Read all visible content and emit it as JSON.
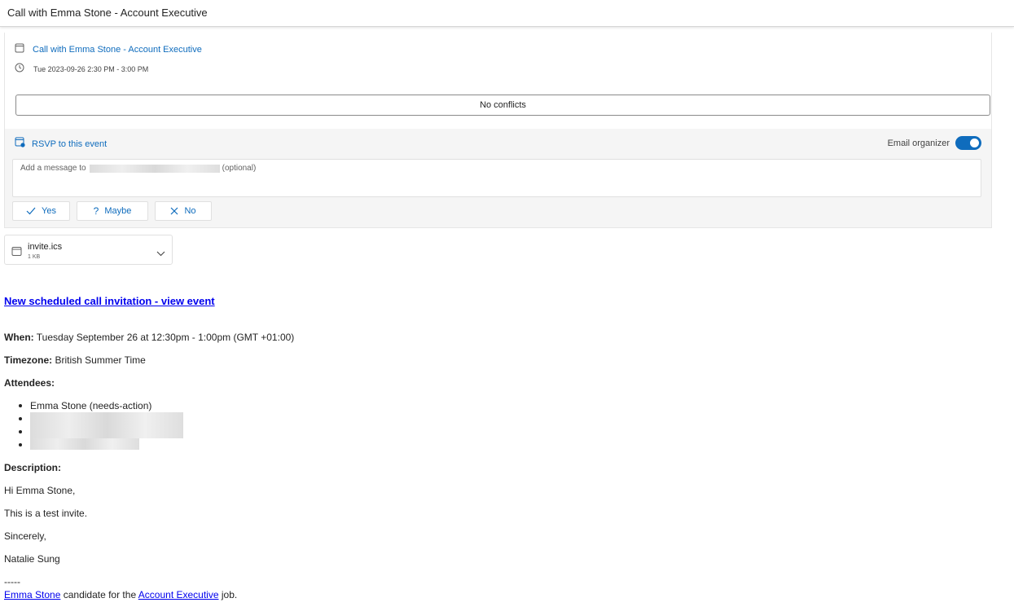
{
  "window": {
    "title": "Call with Emma Stone - Account Executive"
  },
  "event": {
    "title": "Call with Emma Stone - Account Executive",
    "time": "Tue 2023-09-26 2:30 PM - 3:00 PM",
    "conflicts": "No conflicts"
  },
  "rsvp": {
    "label": "RSVP to this event",
    "email_organizer_label": "Email organizer",
    "email_organizer_on": true,
    "message_prefix": "Add a message to",
    "message_suffix": "(optional)",
    "yes": "Yes",
    "maybe": "Maybe",
    "no": "No"
  },
  "attachment": {
    "name": "invite.ics",
    "size": "1 KB"
  },
  "email": {
    "view_event_link": "New scheduled call invitation - view event",
    "when_label": "When:",
    "when_value": "Tuesday September 26 at 12:30pm - 1:00pm (GMT +01:00)",
    "timezone_label": "Timezone:",
    "timezone_value": "British Summer Time",
    "attendees_label": "Attendees:",
    "attendees": [
      "Emma Stone (needs-action)"
    ],
    "description_label": "Description:",
    "greeting": "Hi Emma Stone,",
    "line1": "This is a test invite.",
    "signoff": "Sincerely,",
    "signature": "Natalie Sung",
    "separator": "-----",
    "footer_link_candidate": "Emma Stone",
    "footer_text_mid": "candidate for the",
    "footer_link_job": "Account Executive",
    "footer_text_end": "job."
  }
}
